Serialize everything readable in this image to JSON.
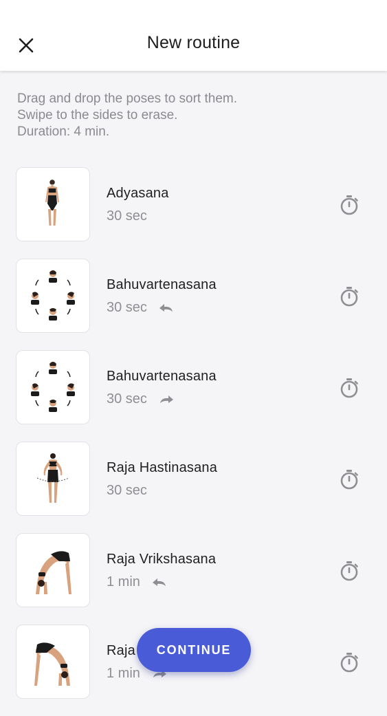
{
  "header": {
    "title": "New routine",
    "close_icon": "close-icon"
  },
  "instructions": {
    "line1": "Drag and drop the poses to sort them.",
    "line2": "Swipe to the sides to erase.",
    "line3": "Duration: 4 min."
  },
  "poses": [
    {
      "name": "Adyasana",
      "duration": "30 sec",
      "direction": ""
    },
    {
      "name": "Bahuvartenasana",
      "duration": "30 sec",
      "direction": "counterclockwise"
    },
    {
      "name": "Bahuvartenasana",
      "duration": "30 sec",
      "direction": "clockwise"
    },
    {
      "name": "Raja Hastinasana",
      "duration": "30 sec",
      "direction": ""
    },
    {
      "name": "Raja Vrikshasana",
      "duration": "1 min",
      "direction": "counterclockwise"
    },
    {
      "name": "Raja",
      "duration": "1 min",
      "direction": "clockwise"
    }
  ],
  "continue_button": {
    "label": "CONTINUE"
  },
  "colors": {
    "accent": "#4a5bd8",
    "secondary_text": "#8e8e93",
    "background": "#f5f5f7"
  }
}
